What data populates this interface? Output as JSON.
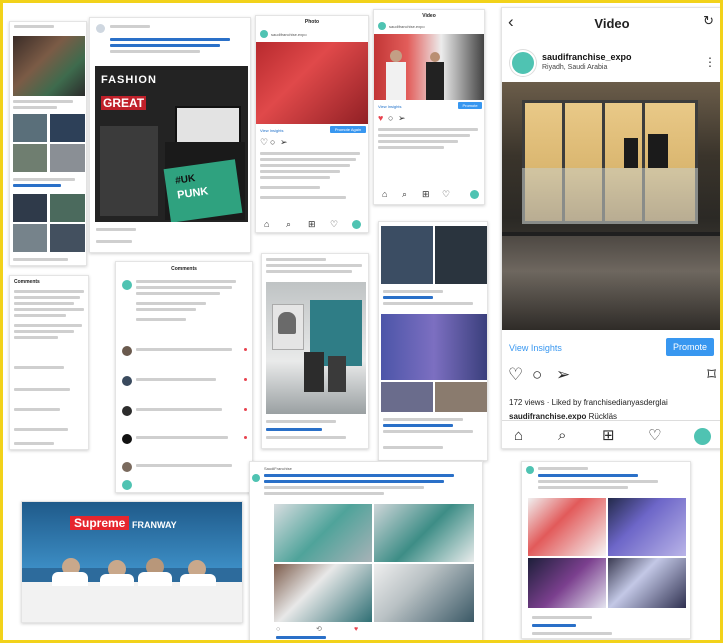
{
  "colors": {
    "frame": "#f2d21a",
    "ig_blue": "#3897f0",
    "twitter_blue": "#1d6fc9",
    "teal": "#4fc3b2"
  },
  "instagram_main": {
    "header_title": "Video",
    "account": "saudifranchise_expo",
    "location": "Riyadh, Saudi Arabia",
    "view_insights": "View Insights",
    "promote": "Promote",
    "views_line": "172 views · Liked by franchisedianyasderglai",
    "caption_user": "saudifranchise.expo",
    "caption_text": "Rückläs",
    "icons": {
      "back": "chevron-left-icon",
      "refresh": "refresh-icon",
      "like": "heart-icon",
      "comment": "comment-icon",
      "share": "send-icon",
      "save": "bookmark-icon",
      "home": "home-icon",
      "search": "search-icon",
      "add": "add-icon",
      "activity": "heart-icon",
      "profile": "avatar"
    }
  },
  "instagram_small": {
    "header_title": "Video",
    "account": "saudifranchise.expo",
    "view_insights": "View Insights",
    "promote": "Promote"
  },
  "instagram_photo": {
    "header_title": "Photo",
    "account": "saudifranchise.expo",
    "view_insights": "View Insights",
    "promote": "Promote Again"
  },
  "comments_panel": {
    "title": "Comments"
  },
  "comments_left": {
    "title": "Comments"
  },
  "tweet_bottom": {
    "handle": "SaudiFranchise"
  },
  "banner": {
    "line1": "Supreme",
    "line2": "FRANWAY"
  },
  "fashion_post": {
    "line1": "FASHION",
    "line2": "GREAT",
    "line3": "#UK",
    "line4": "PUNK"
  }
}
